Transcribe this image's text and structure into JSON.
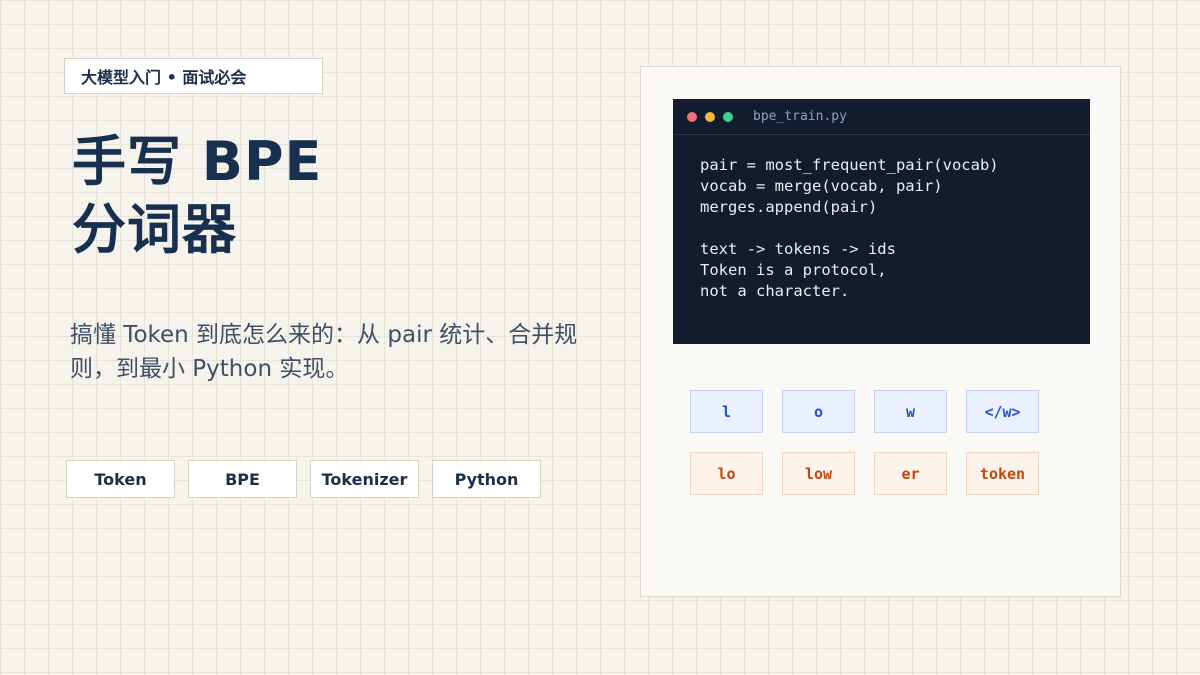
{
  "badge": "大模型入门 • 面试必会",
  "title": {
    "line1": "手写 BPE",
    "line2": "分词器"
  },
  "subtitle": "搞懂 Token 到底怎么来的：从 pair 统计、合并规则，到最小 Python 实现。",
  "tags": [
    "Token",
    "BPE",
    "Tokenizer",
    "Python"
  ],
  "editor": {
    "filename": "bpe_train.py",
    "lines": [
      "pair = most_frequent_pair(vocab)",
      "vocab = merge(vocab, pair)",
      "merges.append(pair)",
      "",
      "text -> tokens -> ids",
      "Token is a protocol,",
      "not a character."
    ]
  },
  "tokens": {
    "base": [
      "l",
      "o",
      "w",
      "</w>"
    ],
    "merged": [
      "lo",
      "low",
      "er",
      "token"
    ]
  },
  "colors": {
    "background": "#f6f3ec",
    "title": "#18304f",
    "editor_bg": "#131b2e",
    "base_token": "#2552c8",
    "merged_token": "#c2460e"
  }
}
